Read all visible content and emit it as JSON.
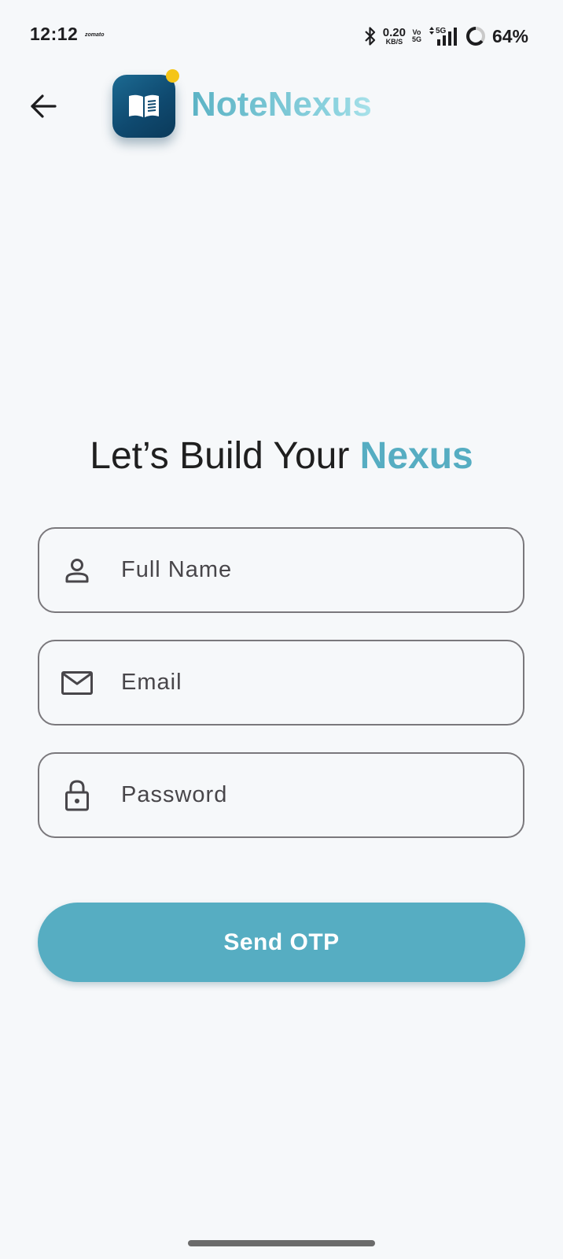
{
  "status_bar": {
    "time": "12:12",
    "notification": "zomato",
    "net_speed_value": "0.20",
    "net_speed_unit": "KB/S",
    "volte_top": "Vo",
    "volte_bottom": "5G",
    "network": "5G",
    "battery": "64%"
  },
  "header": {
    "app_name": "NoteNexus"
  },
  "main": {
    "headline_prefix": "Let’s Build Your ",
    "headline_accent": "Nexus"
  },
  "form": {
    "full_name_placeholder": "Full Name",
    "email_placeholder": "Email",
    "password_placeholder": "Password",
    "submit_label": "Send OTP"
  },
  "colors": {
    "accent": "#56adc2",
    "logo_background": "#0f4a70",
    "logo_badge": "#f5c518",
    "background": "#f6f8fa",
    "field_border": "#7a787c"
  },
  "icons": {
    "back": "arrow-left-icon",
    "logo": "open-book-icon",
    "full_name": "person-icon",
    "email": "mail-icon",
    "password": "lock-icon"
  }
}
